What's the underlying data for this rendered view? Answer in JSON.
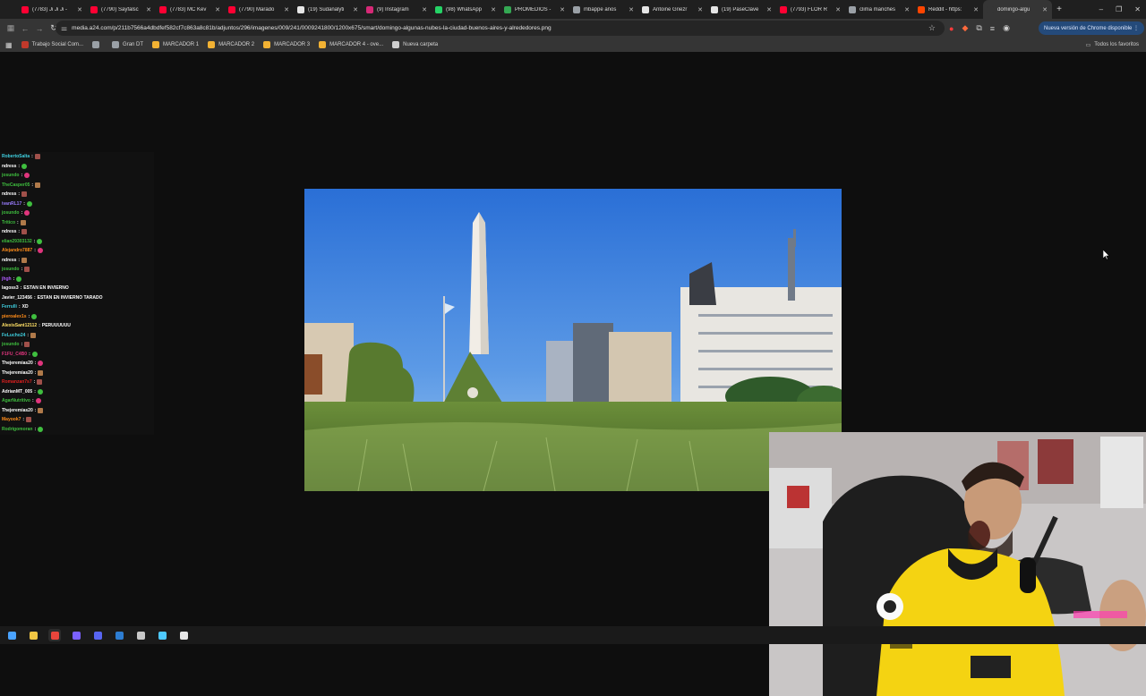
{
  "browser": {
    "tabs": [
      {
        "label": "(7783) Ji Ji Ji -",
        "fav_color": "#ff0033"
      },
      {
        "label": "(7790) Sayfalsc",
        "fav_color": "#ff0033"
      },
      {
        "label": "(7783) MC Kev",
        "fav_color": "#ff0033"
      },
      {
        "label": "(7790) Marado",
        "fav_color": "#ff0033"
      },
      {
        "label": "(19) Sudanalyti",
        "fav_color": "#e6e6e6"
      },
      {
        "label": "(9) Instagram",
        "fav_color": "#d62976"
      },
      {
        "label": "(98) WhatsApp",
        "fav_color": "#25d366"
      },
      {
        "label": "PROMEDIOS -",
        "fav_color": "#34a853"
      },
      {
        "label": "mbappe años",
        "fav_color": "#9aa0a6"
      },
      {
        "label": "Antoine Griezr",
        "fav_color": "#e6e6e6"
      },
      {
        "label": "(19) PaseClave",
        "fav_color": "#e6e6e6"
      },
      {
        "label": "(7793) FLOR R",
        "fav_color": "#ff0033"
      },
      {
        "label": "clima manches",
        "fav_color": "#9aa0a6"
      },
      {
        "label": "Reddit - https:",
        "fav_color": "#ff4500"
      },
      {
        "label": "domingo-algu",
        "fav_color": "#353535",
        "active": true
      }
    ],
    "new_tab": "+",
    "window_controls": {
      "minimize": "–",
      "maximize": "❐",
      "close": "✕"
    },
    "url": "media.a24.com/p/211b7566a4dbdfef582cf7c863a8c81b/adjuntos/296/imagenes/009/241/0009241800/1200x675/smart/domingo-algunas-nubes-la-ciudad-buenos-aires-y-alrededores.png",
    "update_label": "Nueva versión de Chrome disponible",
    "bookmarks": [
      {
        "label": "Trabajo Social Com...",
        "color": "#c0392b"
      },
      {
        "label": "",
        "color": "#9aa0a6"
      },
      {
        "label": "Gran DT",
        "color": "#9aa0a6"
      },
      {
        "label": "MARCADOR 1",
        "color": "#f2b233"
      },
      {
        "label": "MARCADOR 2",
        "color": "#f2b233"
      },
      {
        "label": "MARCADOR 3",
        "color": "#f2b233"
      },
      {
        "label": "MARCADOR 4 - ove...",
        "color": "#f2b233"
      },
      {
        "label": "Nueva carpeta",
        "color": "#cfcfcf"
      }
    ],
    "all_bookmarks": "Todos los favoritos"
  },
  "chat": [
    {
      "user": "RobertoSalta",
      "color": "#3fd0e0",
      "text": ""
    },
    {
      "user": "ndress",
      "color": "#ffffff",
      "text": ""
    },
    {
      "user": "josundo",
      "color": "#3fbf3f",
      "text": ""
    },
    {
      "user": "TheCasper05",
      "color": "#3fbf3f",
      "text": ""
    },
    {
      "user": "ndress",
      "color": "#ffffff",
      "text": ""
    },
    {
      "user": "ivanRL17",
      "color": "#9a7cff",
      "text": ""
    },
    {
      "user": "josundo",
      "color": "#3fbf3f",
      "text": ""
    },
    {
      "user": "Tritico",
      "color": "#3fbf3f",
      "text": ""
    },
    {
      "user": "ndress",
      "color": "#ffffff",
      "text": ""
    },
    {
      "user": "elian29303132",
      "color": "#3fbf3f",
      "text": ""
    },
    {
      "user": "Alejandro7887",
      "color": "#ff8c1a",
      "text": ""
    },
    {
      "user": "ndress",
      "color": "#ffffff",
      "text": ""
    },
    {
      "user": "josundo",
      "color": "#3fbf3f",
      "text": ""
    },
    {
      "user": "jhgh",
      "color": "#b05cff",
      "text": ""
    },
    {
      "user": "lagoss3",
      "color": "#ffffff",
      "text": "ESTAN EN INVIERNO"
    },
    {
      "user": "Javier_123456",
      "color": "#ffffff",
      "text": "ESTAN EN INVIERNO TARADO"
    },
    {
      "user": "Ferrulli",
      "color": "#3fd0e0",
      "text": "XD"
    },
    {
      "user": "pieroalex1s",
      "color": "#ff8c1a",
      "text": ""
    },
    {
      "user": "AlexisSant12112",
      "color": "#ffe066",
      "text": "PERUUUUUU"
    },
    {
      "user": "FeLucho24",
      "color": "#3fd0e0",
      "text": ""
    },
    {
      "user": "josundo",
      "color": "#3fbf3f",
      "text": ""
    },
    {
      "user": "F1FU_C4B0",
      "color": "#e0357d",
      "text": ""
    },
    {
      "user": "Thejeremias20",
      "color": "#ffffff",
      "text": ""
    },
    {
      "user": "Thejeremias20",
      "color": "#ffffff",
      "text": ""
    },
    {
      "user": "Romanzan7s7",
      "color": "#e02020",
      "text": ""
    },
    {
      "user": "AdrianMT_005",
      "color": "#ffffff",
      "text": ""
    },
    {
      "user": "AgarNutritivo",
      "color": "#3fbf3f",
      "text": ""
    },
    {
      "user": "Thejeremias20",
      "color": "#ffffff",
      "text": ""
    },
    {
      "user": "Mayook7",
      "color": "#ff8c1a",
      "text": ""
    },
    {
      "user": "Rodrigomoran",
      "color": "#3fbf3f",
      "text": ""
    }
  ],
  "taskbar": [
    {
      "icon": "windows-start-icon",
      "color": "#4aa3ff"
    },
    {
      "icon": "file-explorer-icon",
      "color": "#f2c744"
    },
    {
      "icon": "chrome-icon",
      "color": "#e8453c",
      "active": true
    },
    {
      "icon": "app-icon",
      "color": "#7b61ff"
    },
    {
      "icon": "discord-icon",
      "color": "#5865f2"
    },
    {
      "icon": "app-icon",
      "color": "#2d7dd2"
    },
    {
      "icon": "obs-icon",
      "color": "#c8c8c8"
    },
    {
      "icon": "app-icon",
      "color": "#4ec9ff"
    },
    {
      "icon": "app-icon",
      "color": "#e6e6e6"
    }
  ]
}
